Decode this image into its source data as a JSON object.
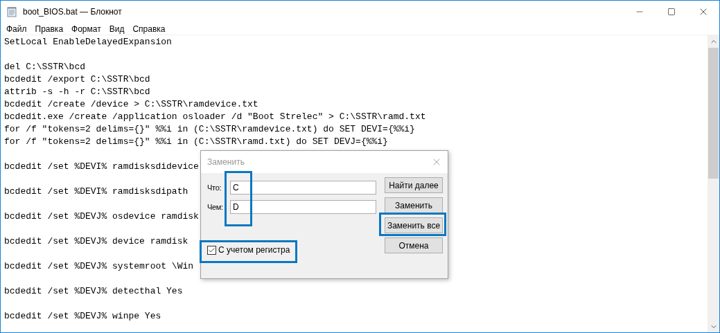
{
  "window": {
    "title": "boot_BIOS.bat — Блокнот"
  },
  "menu": [
    "Файл",
    "Правка",
    "Формат",
    "Вид",
    "Справка"
  ],
  "editor": {
    "blocks": [
      [
        "SetLocal EnableDelayedExpansion"
      ],
      [
        "del C:\\SSTR\\bcd",
        "bcdedit /export C:\\SSTR\\bcd",
        "attrib -s -h -r C:\\SSTR\\bcd",
        "bcdedit /create /device > C:\\SSTR\\ramdevice.txt",
        "bcdedit.exe /create /application osloader /d \"Boot Strelec\" > C:\\SSTR\\ramd.txt",
        "for /f \"tokens=2 delims={}\" %%i in (C:\\SSTR\\ramdevice.txt) do SET DEVI={%%i}",
        "for /f \"tokens=2 delims={}\" %%i in (C:\\SSTR\\ramd.txt) do SET DEVJ={%%i}"
      ],
      [
        "bcdedit /set %DEVI% ramdisksdidevice"
      ],
      [
        "bcdedit /set %DEVI% ramdisksdipath"
      ],
      [
        "bcdedit /set %DEVJ% osdevice ramdisk"
      ],
      [
        "bcdedit /set %DEVJ% device ramdisk"
      ],
      [
        "bcdedit /set %DEVJ% systemroot \\Win"
      ],
      [
        "bcdedit /set %DEVJ% detecthal Yes"
      ],
      [
        "bcdedit /set %DEVJ% winpe Yes"
      ]
    ]
  },
  "dialog": {
    "title": "Заменить",
    "fields": [
      {
        "label": "Что:",
        "value": "C"
      },
      {
        "label": "Чем:",
        "value": "D"
      }
    ],
    "checkbox": {
      "label": "С учетом регистра",
      "checked": true
    },
    "buttons": [
      "Найти далее",
      "Заменить",
      "Заменить все",
      "Отмена"
    ]
  }
}
